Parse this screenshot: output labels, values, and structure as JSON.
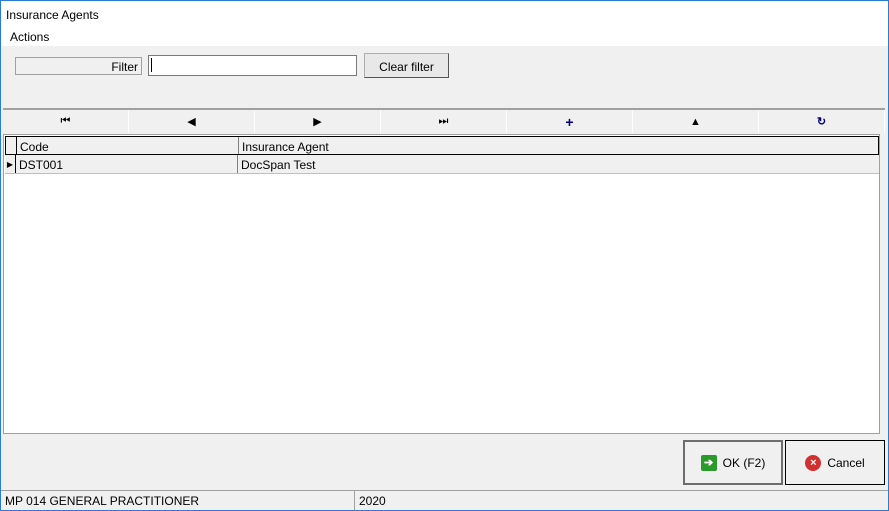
{
  "window": {
    "title": "Insurance Agents"
  },
  "menu": {
    "actions": "Actions"
  },
  "filter": {
    "label": "Filter",
    "value": "",
    "clear_label": "Clear filter"
  },
  "navigator": {
    "first": "⏮",
    "prior": "◀",
    "next": "▶",
    "last": "⏭",
    "insert": "+",
    "edit": "▲",
    "refresh": "↻"
  },
  "grid": {
    "columns": [
      "Code",
      "Insurance Agent"
    ],
    "rows": [
      {
        "code": "DST001",
        "agent": "DocSpan Test"
      }
    ]
  },
  "buttons": {
    "ok": "OK (F2)",
    "cancel": "Cancel"
  },
  "status": {
    "practice": "MP 014 GENERAL PRACTITIONER",
    "year": "2020"
  }
}
